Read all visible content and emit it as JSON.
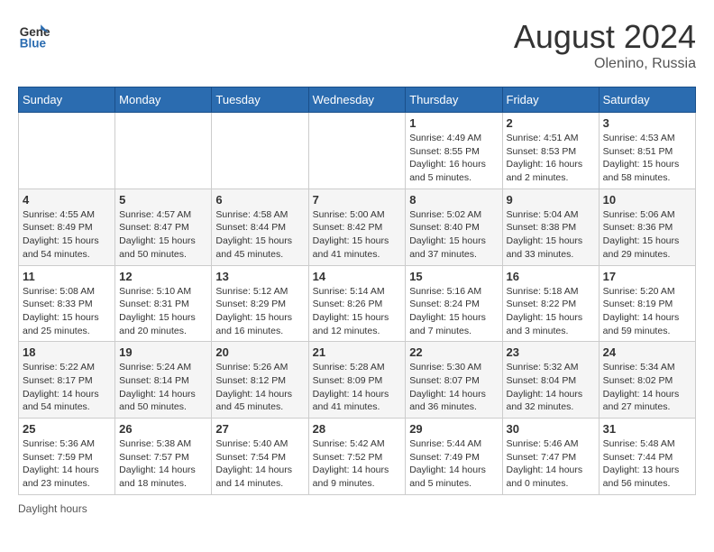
{
  "header": {
    "logo_general": "General",
    "logo_blue": "Blue",
    "month_year": "August 2024",
    "location": "Olenino, Russia"
  },
  "footer": {
    "daylight_note": "Daylight hours"
  },
  "days_of_week": [
    "Sunday",
    "Monday",
    "Tuesday",
    "Wednesday",
    "Thursday",
    "Friday",
    "Saturday"
  ],
  "weeks": [
    [
      {
        "day": "",
        "info": ""
      },
      {
        "day": "",
        "info": ""
      },
      {
        "day": "",
        "info": ""
      },
      {
        "day": "",
        "info": ""
      },
      {
        "day": "1",
        "info": "Sunrise: 4:49 AM\nSunset: 8:55 PM\nDaylight: 16 hours\nand 5 minutes."
      },
      {
        "day": "2",
        "info": "Sunrise: 4:51 AM\nSunset: 8:53 PM\nDaylight: 16 hours\nand 2 minutes."
      },
      {
        "day": "3",
        "info": "Sunrise: 4:53 AM\nSunset: 8:51 PM\nDaylight: 15 hours\nand 58 minutes."
      }
    ],
    [
      {
        "day": "4",
        "info": "Sunrise: 4:55 AM\nSunset: 8:49 PM\nDaylight: 15 hours\nand 54 minutes."
      },
      {
        "day": "5",
        "info": "Sunrise: 4:57 AM\nSunset: 8:47 PM\nDaylight: 15 hours\nand 50 minutes."
      },
      {
        "day": "6",
        "info": "Sunrise: 4:58 AM\nSunset: 8:44 PM\nDaylight: 15 hours\nand 45 minutes."
      },
      {
        "day": "7",
        "info": "Sunrise: 5:00 AM\nSunset: 8:42 PM\nDaylight: 15 hours\nand 41 minutes."
      },
      {
        "day": "8",
        "info": "Sunrise: 5:02 AM\nSunset: 8:40 PM\nDaylight: 15 hours\nand 37 minutes."
      },
      {
        "day": "9",
        "info": "Sunrise: 5:04 AM\nSunset: 8:38 PM\nDaylight: 15 hours\nand 33 minutes."
      },
      {
        "day": "10",
        "info": "Sunrise: 5:06 AM\nSunset: 8:36 PM\nDaylight: 15 hours\nand 29 minutes."
      }
    ],
    [
      {
        "day": "11",
        "info": "Sunrise: 5:08 AM\nSunset: 8:33 PM\nDaylight: 15 hours\nand 25 minutes."
      },
      {
        "day": "12",
        "info": "Sunrise: 5:10 AM\nSunset: 8:31 PM\nDaylight: 15 hours\nand 20 minutes."
      },
      {
        "day": "13",
        "info": "Sunrise: 5:12 AM\nSunset: 8:29 PM\nDaylight: 15 hours\nand 16 minutes."
      },
      {
        "day": "14",
        "info": "Sunrise: 5:14 AM\nSunset: 8:26 PM\nDaylight: 15 hours\nand 12 minutes."
      },
      {
        "day": "15",
        "info": "Sunrise: 5:16 AM\nSunset: 8:24 PM\nDaylight: 15 hours\nand 7 minutes."
      },
      {
        "day": "16",
        "info": "Sunrise: 5:18 AM\nSunset: 8:22 PM\nDaylight: 15 hours\nand 3 minutes."
      },
      {
        "day": "17",
        "info": "Sunrise: 5:20 AM\nSunset: 8:19 PM\nDaylight: 14 hours\nand 59 minutes."
      }
    ],
    [
      {
        "day": "18",
        "info": "Sunrise: 5:22 AM\nSunset: 8:17 PM\nDaylight: 14 hours\nand 54 minutes."
      },
      {
        "day": "19",
        "info": "Sunrise: 5:24 AM\nSunset: 8:14 PM\nDaylight: 14 hours\nand 50 minutes."
      },
      {
        "day": "20",
        "info": "Sunrise: 5:26 AM\nSunset: 8:12 PM\nDaylight: 14 hours\nand 45 minutes."
      },
      {
        "day": "21",
        "info": "Sunrise: 5:28 AM\nSunset: 8:09 PM\nDaylight: 14 hours\nand 41 minutes."
      },
      {
        "day": "22",
        "info": "Sunrise: 5:30 AM\nSunset: 8:07 PM\nDaylight: 14 hours\nand 36 minutes."
      },
      {
        "day": "23",
        "info": "Sunrise: 5:32 AM\nSunset: 8:04 PM\nDaylight: 14 hours\nand 32 minutes."
      },
      {
        "day": "24",
        "info": "Sunrise: 5:34 AM\nSunset: 8:02 PM\nDaylight: 14 hours\nand 27 minutes."
      }
    ],
    [
      {
        "day": "25",
        "info": "Sunrise: 5:36 AM\nSunset: 7:59 PM\nDaylight: 14 hours\nand 23 minutes."
      },
      {
        "day": "26",
        "info": "Sunrise: 5:38 AM\nSunset: 7:57 PM\nDaylight: 14 hours\nand 18 minutes."
      },
      {
        "day": "27",
        "info": "Sunrise: 5:40 AM\nSunset: 7:54 PM\nDaylight: 14 hours\nand 14 minutes."
      },
      {
        "day": "28",
        "info": "Sunrise: 5:42 AM\nSunset: 7:52 PM\nDaylight: 14 hours\nand 9 minutes."
      },
      {
        "day": "29",
        "info": "Sunrise: 5:44 AM\nSunset: 7:49 PM\nDaylight: 14 hours\nand 5 minutes."
      },
      {
        "day": "30",
        "info": "Sunrise: 5:46 AM\nSunset: 7:47 PM\nDaylight: 14 hours\nand 0 minutes."
      },
      {
        "day": "31",
        "info": "Sunrise: 5:48 AM\nSunset: 7:44 PM\nDaylight: 13 hours\nand 56 minutes."
      }
    ]
  ]
}
